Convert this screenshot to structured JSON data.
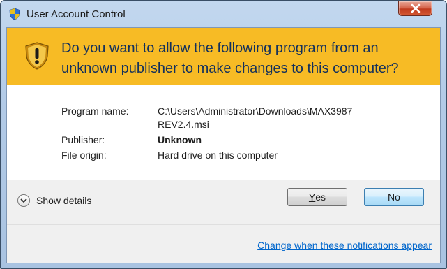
{
  "window": {
    "title": "User Account Control",
    "close_glyph": "close-icon"
  },
  "banner": {
    "icon": "shield-warning-icon",
    "message": "Do you want to allow the following program from an unknown publisher to make changes to this computer?"
  },
  "details": {
    "program_name_label": "Program name:",
    "program_name_value_line1": "C:\\Users\\Administrator\\Downloads\\MAX3987",
    "program_name_value_line2": "REV2.4.msi",
    "publisher_label": "Publisher:",
    "publisher_value": "Unknown",
    "file_origin_label": "File origin:",
    "file_origin_value": "Hard drive on this computer"
  },
  "footer": {
    "show_details_prefix": "Show ",
    "show_details_accel": "d",
    "show_details_suffix": "etails",
    "yes_accel": "Y",
    "yes_rest": "es",
    "no_label": "No",
    "notifications_link": "Change when these notifications appear"
  },
  "colors": {
    "banner": "#f7bb25",
    "banner_text": "#13305c",
    "link": "#0066cc"
  }
}
